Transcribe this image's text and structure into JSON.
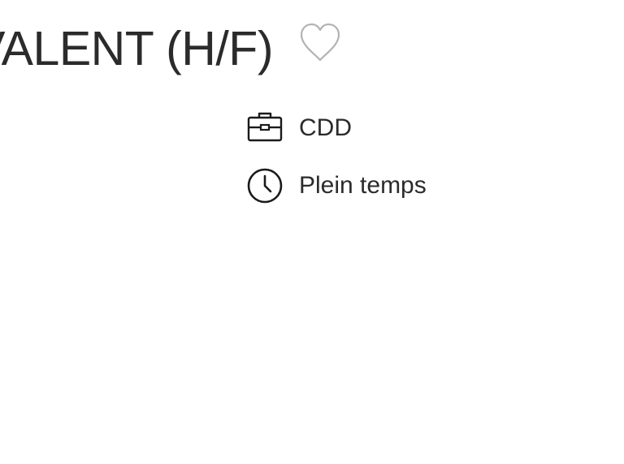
{
  "job": {
    "title": "VALENT (H/F)",
    "favorite_icon": "heart-outline-icon",
    "contract_type": {
      "icon": "briefcase-icon",
      "label": "CDD"
    },
    "work_time": {
      "icon": "clock-icon",
      "label": "Plein temps"
    }
  },
  "colors": {
    "text": "#2b2b2b",
    "heart_outline": "#b3b3b3",
    "icon_stroke": "#1a1a1a",
    "background": "#ffffff"
  }
}
